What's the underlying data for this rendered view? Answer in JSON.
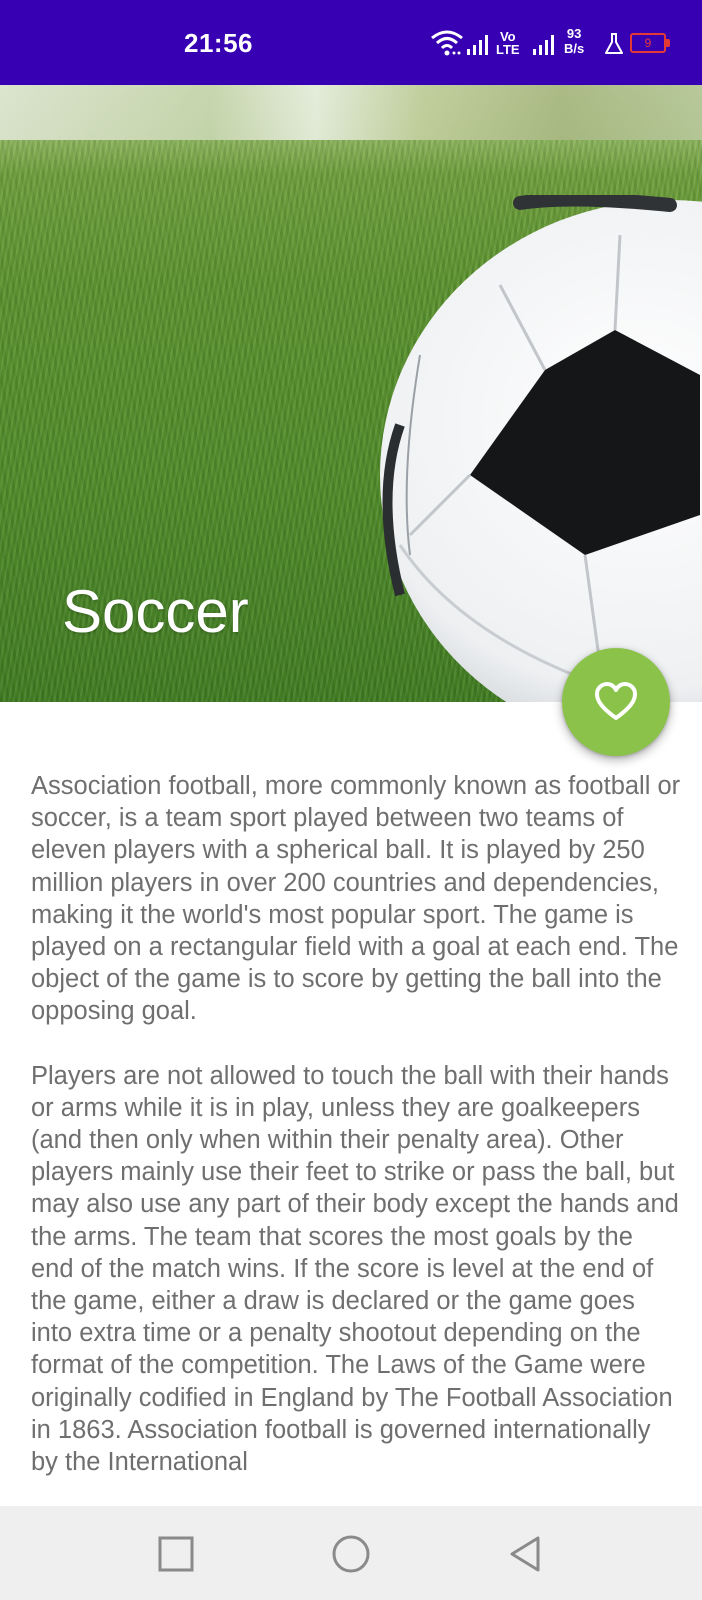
{
  "status_bar": {
    "time": "21:56",
    "volte_line1": "Vo",
    "volte_line2": "LTE",
    "net_speed_value": "93",
    "net_speed_unit": "B/s",
    "battery_level": "9",
    "background_color": "#3700b3",
    "battery_color": "#e53935"
  },
  "hero": {
    "title": "Soccer",
    "image_icon": "soccer-ball-on-grass"
  },
  "fab": {
    "icon": "heart-outline-icon",
    "color": "#8bc34a"
  },
  "article": {
    "paragraphs": [
      "Association football, more commonly known as football or soccer, is a team sport played between two teams of eleven players with a spherical ball. It is played by 250 million players in over 200 countries and dependencies, making it the world's most popular sport. The game is played on a rectangular field with a goal at each end. The object of the game is to score by getting the ball into the opposing goal.",
      "Players are not allowed to touch the ball with their hands or arms while it is in play, unless they are goalkeepers (and then only when within their penalty area). Other players mainly use their feet to strike or pass the ball, but may also use any part of their body except the hands and the arms. The team that scores the most goals by the end of the match wins. If the score is level at the end of the game, either a draw is declared or the game goes into extra time or a penalty shootout depending on the format of the competition. The Laws of the Game were originally codified in England by The Football Association in 1863. Association football is governed internationally by the International"
    ]
  },
  "nav_bar": {
    "buttons": [
      "recents-square-icon",
      "home-circle-icon",
      "back-triangle-icon"
    ]
  }
}
